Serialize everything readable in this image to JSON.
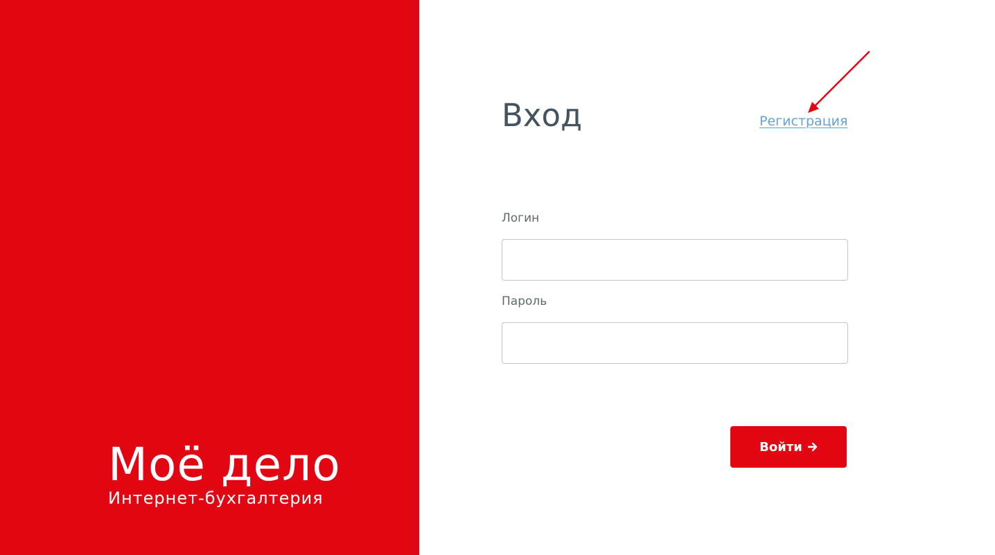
{
  "brand": {
    "logo_title": "Моё дело",
    "logo_subtitle": "Интернет-бухгалтерия",
    "background_color": "#e20613"
  },
  "login": {
    "heading": "Вход",
    "register_link": "Регистрация",
    "login_label": "Логин",
    "login_value": "",
    "password_label": "Пароль",
    "password_value": "",
    "submit_label": "Войти",
    "submit_icon": "arrow-right-icon"
  },
  "annotation": {
    "type": "arrow",
    "target": "register-link",
    "color": "#e20613"
  }
}
